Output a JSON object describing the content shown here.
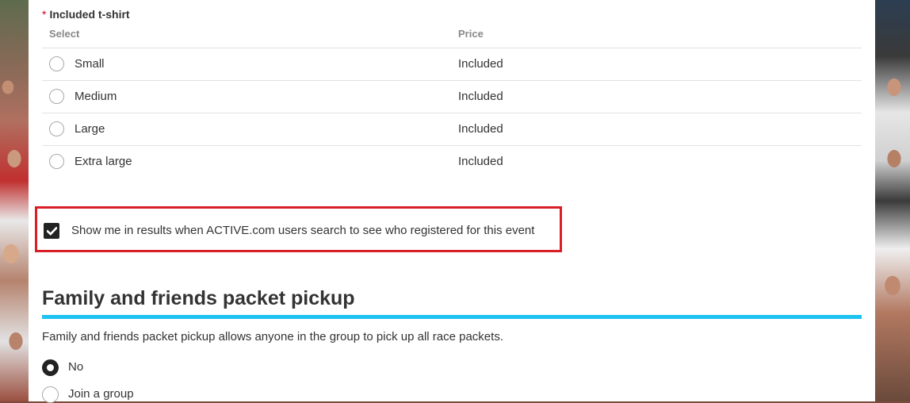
{
  "tshirt_section": {
    "required_marker": "*",
    "label": "Included t-shirt",
    "columns": {
      "select": "Select",
      "price": "Price"
    },
    "options": [
      {
        "label": "Small",
        "price": "Included"
      },
      {
        "label": "Medium",
        "price": "Included"
      },
      {
        "label": "Large",
        "price": "Included"
      },
      {
        "label": "Extra large",
        "price": "Included"
      }
    ]
  },
  "visibility": {
    "checked": true,
    "label": "Show me in results when ACTIVE.com users search to see who registered for this event"
  },
  "packet_pickup": {
    "title": "Family and friends packet pickup",
    "description": "Family and friends packet pickup allows anyone in the group to pick up all race packets.",
    "options": [
      {
        "label": "No",
        "selected": true
      },
      {
        "label": "Join a group",
        "selected": false
      }
    ]
  },
  "colors": {
    "accent_rule": "#1ec2f0",
    "highlight_border": "#d91f26",
    "required": "#d0021b"
  }
}
